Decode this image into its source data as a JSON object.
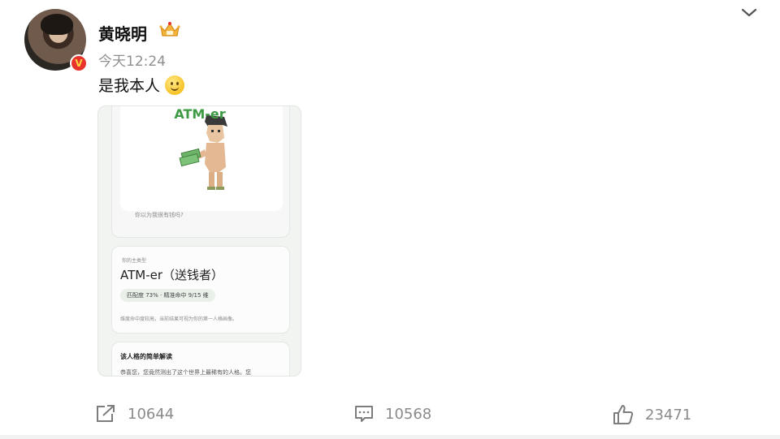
{
  "post": {
    "username": "黄晓明",
    "timestamp": "今天12:24",
    "text": "是我本人",
    "icons": {
      "crown": "crown-badge-icon",
      "emoji": "smile-emoji-icon",
      "menu": "chevron-down-icon",
      "verified": "verified-v-icon"
    },
    "verified_mark": "V"
  },
  "embedded_image": {
    "type_title": "ATM-er",
    "question": "你以为我很有钱吗?",
    "main_type_label": "你的主类型",
    "main_type": "ATM-er（送钱者）",
    "match_pill": "匹配度 73% · 精准命中 9/15 维",
    "match_note": "维度命中度较高，当前结果可视为你的第一人格画像。",
    "interp_title": "该人格的简单解读",
    "interp_text": "恭喜您，您竟然测出了这个世界上最稀有的人格。您"
  },
  "actions": {
    "share_count": "10644",
    "comment_count": "10568",
    "like_count": "23471"
  },
  "colors": {
    "accent_green": "#3e9a44",
    "muted_text": "#8a8a8a",
    "verified_red": "#e8322b"
  }
}
